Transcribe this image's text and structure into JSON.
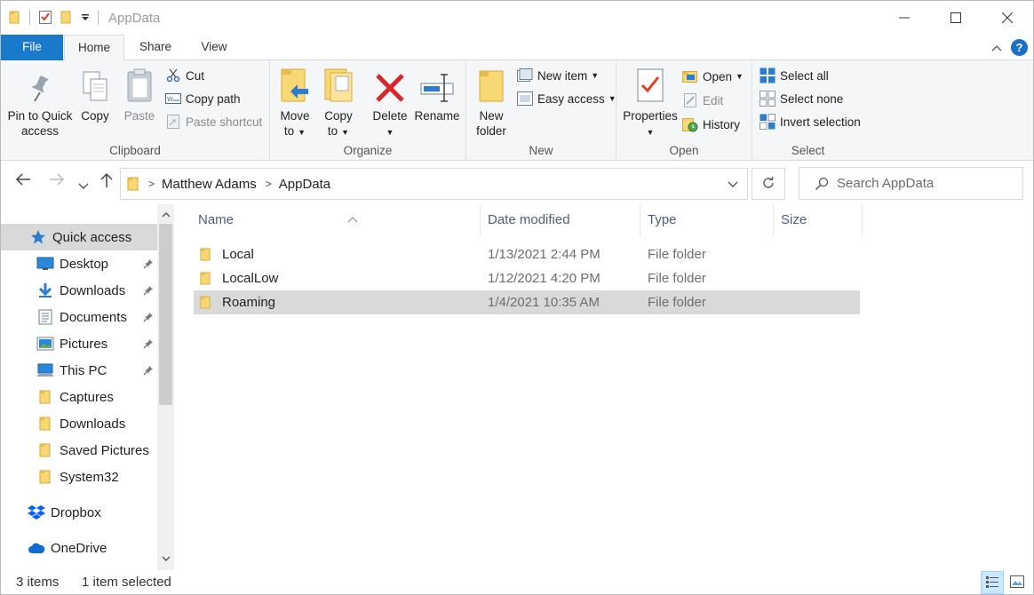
{
  "window": {
    "title": "AppData"
  },
  "ribbon": {
    "tabs": {
      "file": "File",
      "home": "Home",
      "share": "Share",
      "view": "View"
    },
    "clipboard": {
      "label": "Clipboard",
      "pin_line1": "Pin to Quick",
      "pin_line2": "access",
      "copy": "Copy",
      "paste": "Paste",
      "cut": "Cut",
      "copy_path": "Copy path",
      "paste_shortcut": "Paste shortcut"
    },
    "organize": {
      "label": "Organize",
      "move_to_line1": "Move",
      "move_to_line2": "to",
      "copy_to_line1": "Copy",
      "copy_to_line2": "to",
      "delete": "Delete",
      "rename": "Rename"
    },
    "new": {
      "label": "New",
      "new_folder_line1": "New",
      "new_folder_line2": "folder",
      "new_item": "New item",
      "easy_access": "Easy access"
    },
    "open": {
      "label": "Open",
      "properties": "Properties",
      "open": "Open",
      "edit": "Edit",
      "history": "History"
    },
    "select": {
      "label": "Select",
      "select_all": "Select all",
      "select_none": "Select none",
      "invert_selection": "Invert selection"
    }
  },
  "address": {
    "breadcrumbs": [
      "Matthew Adams",
      "AppData"
    ],
    "search_placeholder": "Search AppData"
  },
  "sidebar": {
    "quick_access": "Quick access",
    "items": [
      {
        "label": "Desktop",
        "icon": "desktop-icon",
        "pinned": true
      },
      {
        "label": "Downloads",
        "icon": "download-icon",
        "pinned": true
      },
      {
        "label": "Documents",
        "icon": "documents-icon",
        "pinned": true
      },
      {
        "label": "Pictures",
        "icon": "pictures-icon",
        "pinned": true
      },
      {
        "label": "This PC",
        "icon": "this-pc-icon",
        "pinned": true
      },
      {
        "label": "Captures",
        "icon": "folder-icon",
        "pinned": false
      },
      {
        "label": "Downloads",
        "icon": "folder-icon",
        "pinned": false
      },
      {
        "label": "Saved Pictures",
        "icon": "folder-icon",
        "pinned": false
      },
      {
        "label": "System32",
        "icon": "folder-icon",
        "pinned": false
      }
    ],
    "dropbox": "Dropbox",
    "onedrive": "OneDrive"
  },
  "filelist": {
    "columns": {
      "name": "Name",
      "date_modified": "Date modified",
      "type": "Type",
      "size": "Size"
    },
    "rows": [
      {
        "name": "Local",
        "date": "1/13/2021 2:44 PM",
        "type": "File folder",
        "size": ""
      },
      {
        "name": "LocalLow",
        "date": "1/12/2021 4:20 PM",
        "type": "File folder",
        "size": ""
      },
      {
        "name": "Roaming",
        "date": "1/4/2021 10:35 AM",
        "type": "File folder",
        "size": "",
        "selected": true
      }
    ]
  },
  "status": {
    "item_count": "3 items",
    "selection": "1 item selected"
  },
  "colors": {
    "accent": "#1979ca",
    "folder": "#f8d775",
    "selection": "#d9d9d9",
    "delete_red": "#d9262b"
  }
}
